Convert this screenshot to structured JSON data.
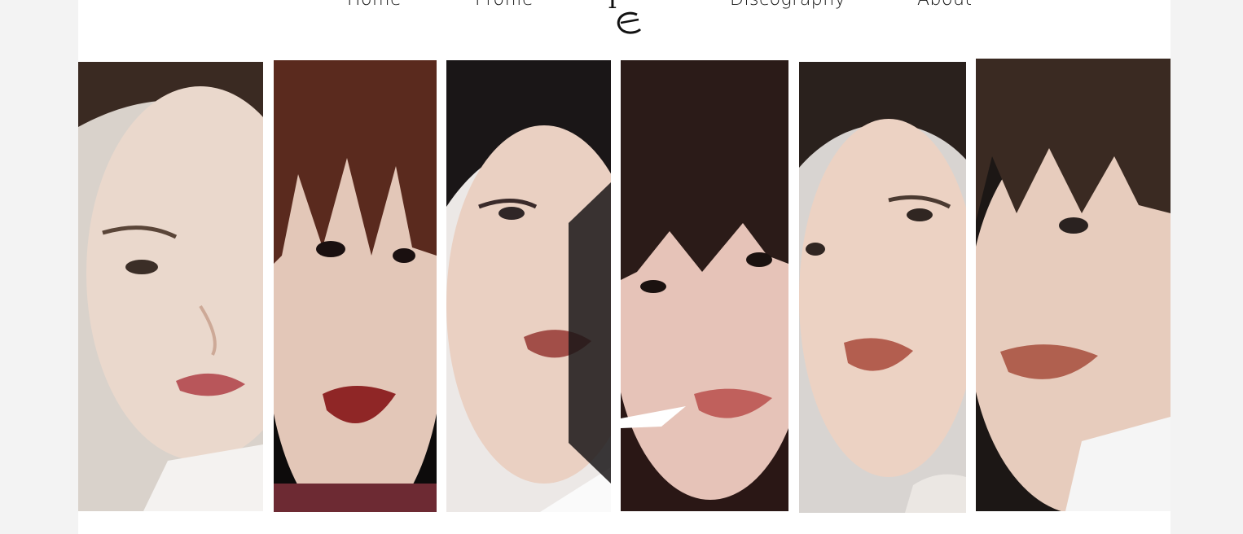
{
  "nav": {
    "home": "Home",
    "profile": "Profile",
    "discography": "Discography",
    "about": "About"
  },
  "logo_icon": "ive-logo-icon",
  "members": [
    {
      "photo_icon": "member-portrait-1",
      "palette": {
        "bg": "#d9d2cb",
        "hair": "#3a2a22",
        "skin": "#ead8cc",
        "lip": "#b8565a",
        "cloth": "#f4f2f0"
      }
    },
    {
      "photo_icon": "member-portrait-2",
      "palette": {
        "bg": "#0d0b0b",
        "hair": "#5a2a1e",
        "skin": "#e3c7b8",
        "lip": "#8f2626",
        "cloth": "#6d2a33"
      }
    },
    {
      "photo_icon": "member-portrait-3",
      "palette": {
        "bg": "#ece8e6",
        "hair": "#1a1617",
        "skin": "#ead0c2",
        "lip": "#a24e48",
        "cloth": "#fafafa"
      }
    },
    {
      "photo_icon": "member-portrait-4",
      "palette": {
        "bg": "#2a1715",
        "hair": "#2b1b18",
        "skin": "#e6c3b8",
        "lip": "#c0605c",
        "cloth": "#ffffff"
      }
    },
    {
      "photo_icon": "member-portrait-5",
      "palette": {
        "bg": "#d8d4d1",
        "hair": "#2a211d",
        "skin": "#ecd2c3",
        "lip": "#b35e4f",
        "cloth": "#ebe7e3"
      }
    },
    {
      "photo_icon": "member-portrait-6",
      "palette": {
        "bg": "#1c1715",
        "hair": "#3a2a22",
        "skin": "#e7ccbd",
        "lip": "#b0604f",
        "cloth": "#f5f5f5"
      }
    }
  ]
}
